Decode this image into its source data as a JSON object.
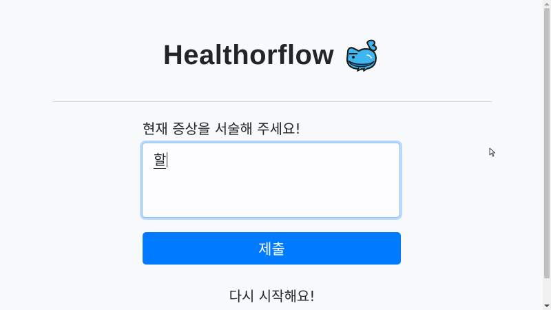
{
  "header": {
    "title": "Healthorflow",
    "logo_icon": "whale-icon"
  },
  "form": {
    "prompt": "현재 증상을 서술해 주세요!",
    "symptom_input": {
      "value": "할"
    },
    "submit_label": "제출"
  },
  "footer": {
    "restart_label": "다시 시작해요!"
  },
  "colors": {
    "primary": "#007bff",
    "background": "#f8f9fa",
    "text": "#212529",
    "whale": "#3fb6f0"
  }
}
